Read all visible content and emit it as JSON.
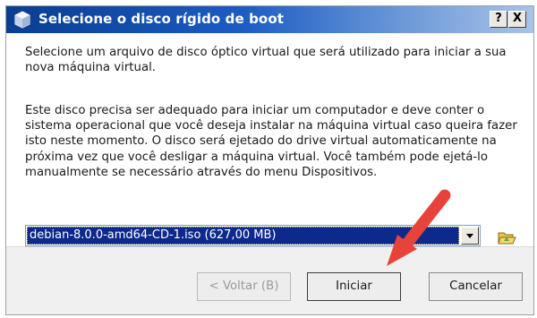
{
  "window": {
    "title": "Selecione o disco rígido de boot",
    "help_label": "?",
    "close_label": "X"
  },
  "content": {
    "paragraph1": "Selecione um arquivo de disco óptico virtual que será utilizado para iniciar a sua nova máquina virtual.",
    "paragraph2": "Este disco precisa ser adequado para iniciar um computador e deve conter o sistema operacional que você deseja instalar na máquina virtual caso queira fazer isto neste momento. O disco será ejetado do drive virtual automaticamente na próxima vez que você desligar a máquina virtual. Você também pode ejetá-lo manualmente se necessário através do menu Dispositivos."
  },
  "disk_select": {
    "selected": "debian-8.0.0-amd64-CD-1.iso (627,00 MB)"
  },
  "buttons": {
    "back": "< Voltar (B)",
    "start": "Iniciar",
    "cancel": "Cancelar"
  },
  "colors": {
    "titlebar": "#0a3d91",
    "selection": "#0b2a8c",
    "annotation_arrow": "#e8433a"
  },
  "icons": {
    "title": "virtualbox-icon",
    "folder": "folder-open-icon"
  }
}
